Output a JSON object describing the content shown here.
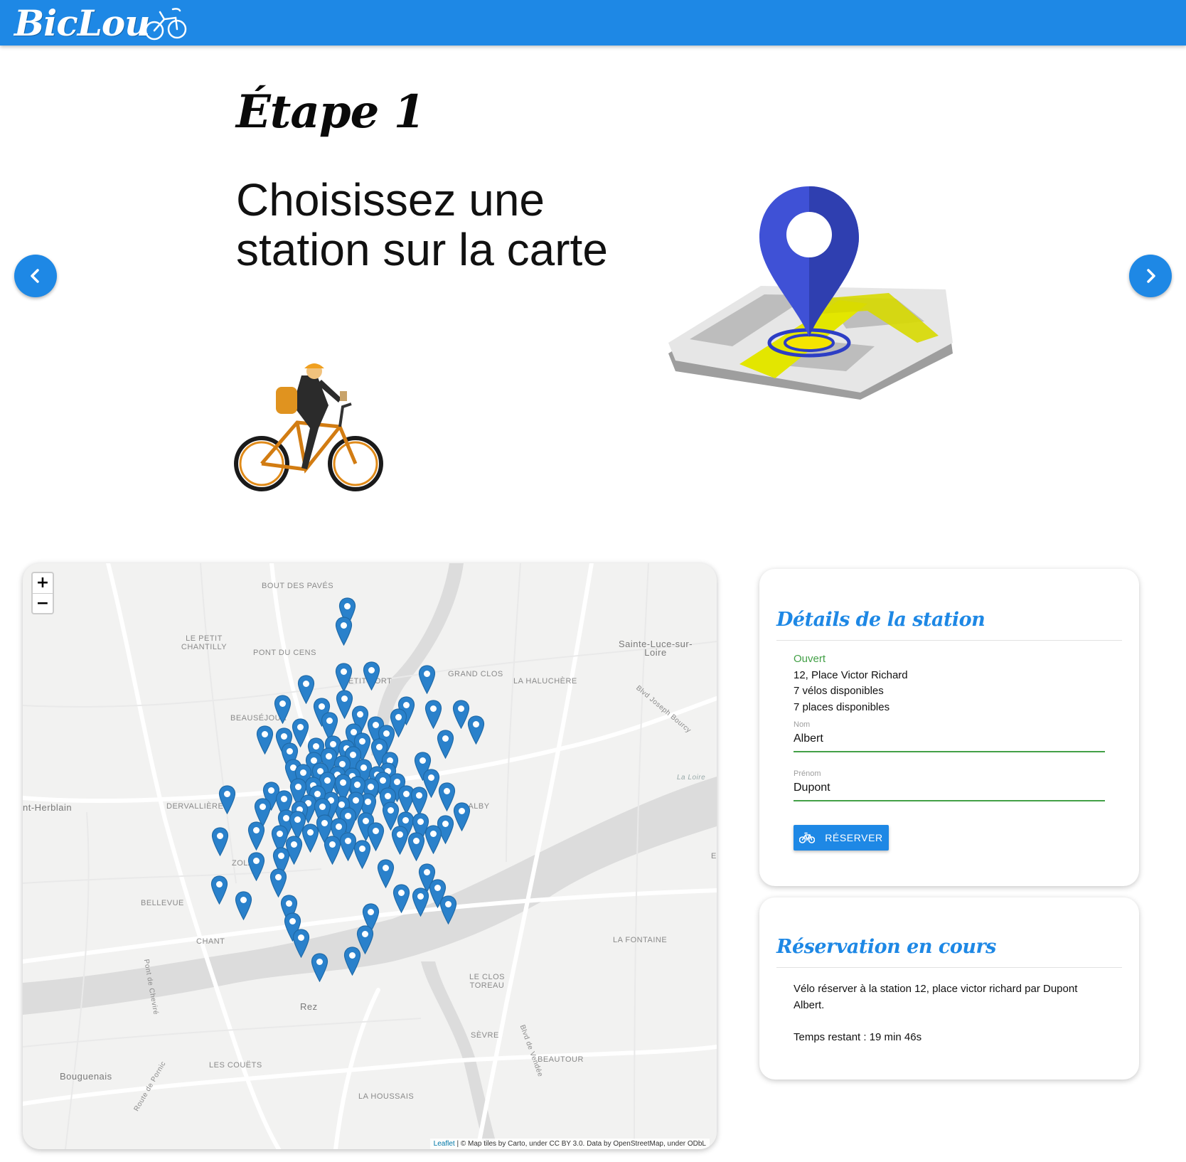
{
  "header": {
    "brand": "BicLou",
    "accent_color": "#1e88e5"
  },
  "slider": {
    "step_title": "Étape 1",
    "step_text": "Choisissez une station sur la carte",
    "prev_icon": "chevron-left-icon",
    "next_icon": "chevron-right-icon",
    "illustrations": [
      "map-pin-illustration",
      "cyclist-illustration"
    ]
  },
  "map": {
    "zoom_in": "+",
    "zoom_out": "−",
    "labels": {
      "bout_des_paves": "BOUT DES PAVÉS",
      "le_petit_chantilly": "LE PETIT CHANTILLY",
      "pont_du_cens": "PONT DU CENS",
      "petit_port": "PETIT PORT",
      "grand_clos": "GRAND CLOS",
      "la_haluchere": "LA HALUCHÈRE",
      "sainte_luce": "Sainte-Luce-sur-Loire",
      "beausejour": "BEAUSÉJOUR",
      "blvd_joseph_bourcy": "Blvd Joseph Bourcy",
      "la_loire": "La Loire",
      "saint_herblain": "nt-Herblain",
      "dervallieres": "DERVALLIÈRES",
      "doulon": "DALBY",
      "zola": "ZOLA",
      "bellevue": "BELLEVUE",
      "chantenay": "CHANT",
      "la_fontaine": "LA FONTAINE",
      "pont_de_cheviré": "Pont de Cheviré",
      "reze": "Rez",
      "clos_toreau": "LE CLOS TOREAU",
      "sevre": "SÈVRE",
      "beautour": "BEAUTOUR",
      "blvd_de_vendee": "Blvd de Vendée",
      "les_couets": "LES COUËTS",
      "bouguenais": "Bouguenais",
      "route_de_pornic": "Route de Pornic",
      "la_houssais": "LA HOUSSAIS",
      "edge_e": "E"
    },
    "attribution_link": "Leaflet",
    "attribution_text": " | © Map tiles by Carto, under CC BY 3.0. Data by OpenStreetMap, under ODbL",
    "marker_color": "#2a81cb",
    "marker_icon": "map-marker-icon"
  },
  "details": {
    "title": "Détails de la station",
    "status": "Ouvert",
    "status_color": "#43a047",
    "address": "12, Place Victor Richard",
    "bikes": "7 vélos disponibles",
    "places": "7 places disponibles",
    "nom_label": "Nom",
    "nom_value": "Albert",
    "prenom_label": "Prénom",
    "prenom_value": "Dupont",
    "reserve_label": "Réserver",
    "reserve_icon": "bicycle-icon"
  },
  "reservation": {
    "title": "Réservation en cours",
    "text": "Vélo réserver à la station 12, place victor richard par Dupont Albert.",
    "timer": "Temps restant : 19 min 46s"
  }
}
